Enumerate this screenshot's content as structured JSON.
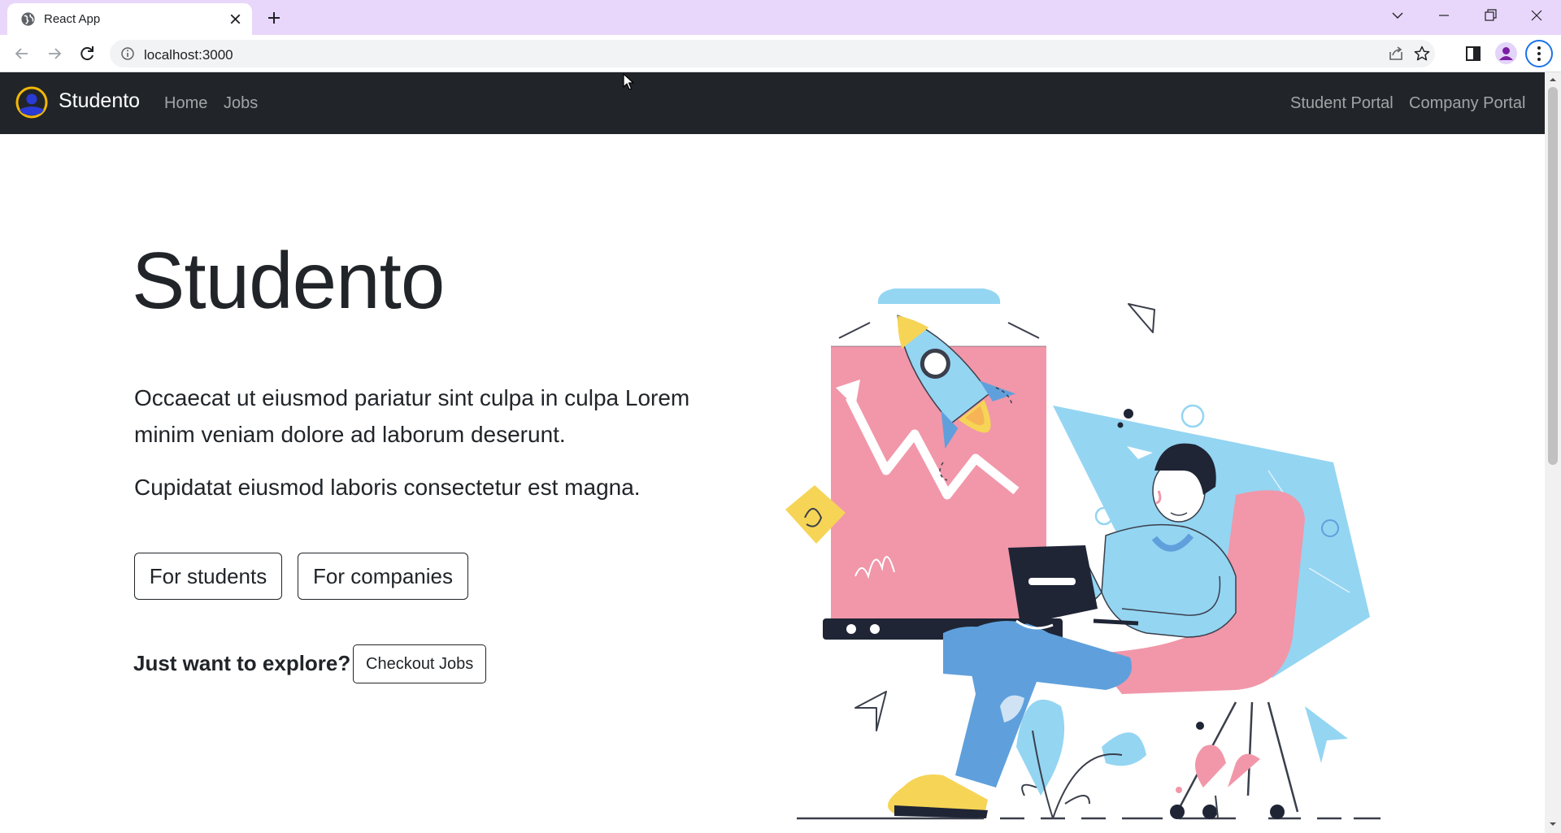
{
  "browser": {
    "tab_title": "React App",
    "url": "localhost:3000"
  },
  "navbar": {
    "brand": "Studento",
    "links": [
      "Home",
      "Jobs"
    ],
    "right_links": [
      "Student Portal",
      "Company Portal"
    ]
  },
  "hero": {
    "title": "Studento",
    "paragraph1": "Occaecat ut eiusmod pariatur sint culpa in culpa Lorem minim veniam dolore ad laborum deserunt.",
    "paragraph2": "Cupidatat eiusmod laboris consectetur est magna.",
    "students_button": "For students",
    "companies_button": "For companies",
    "explore_label": "Just want to explore?",
    "jobs_button": "Checkout Jobs"
  },
  "colors": {
    "tabstrip": "#e9d7fb",
    "navbar": "#212529",
    "accent_pink": "#f197a9",
    "accent_blue": "#94d5f2",
    "accent_yellow": "#f6d456"
  },
  "icons": [
    "globe-icon",
    "close-icon",
    "plus-icon",
    "chevron-down-icon",
    "minimize-icon",
    "restore-icon",
    "back-arrow-icon",
    "forward-arrow-icon",
    "reload-icon",
    "info-icon",
    "share-icon",
    "star-icon",
    "side-panel-icon",
    "profile-icon",
    "more-icon",
    "logo-icon"
  ]
}
